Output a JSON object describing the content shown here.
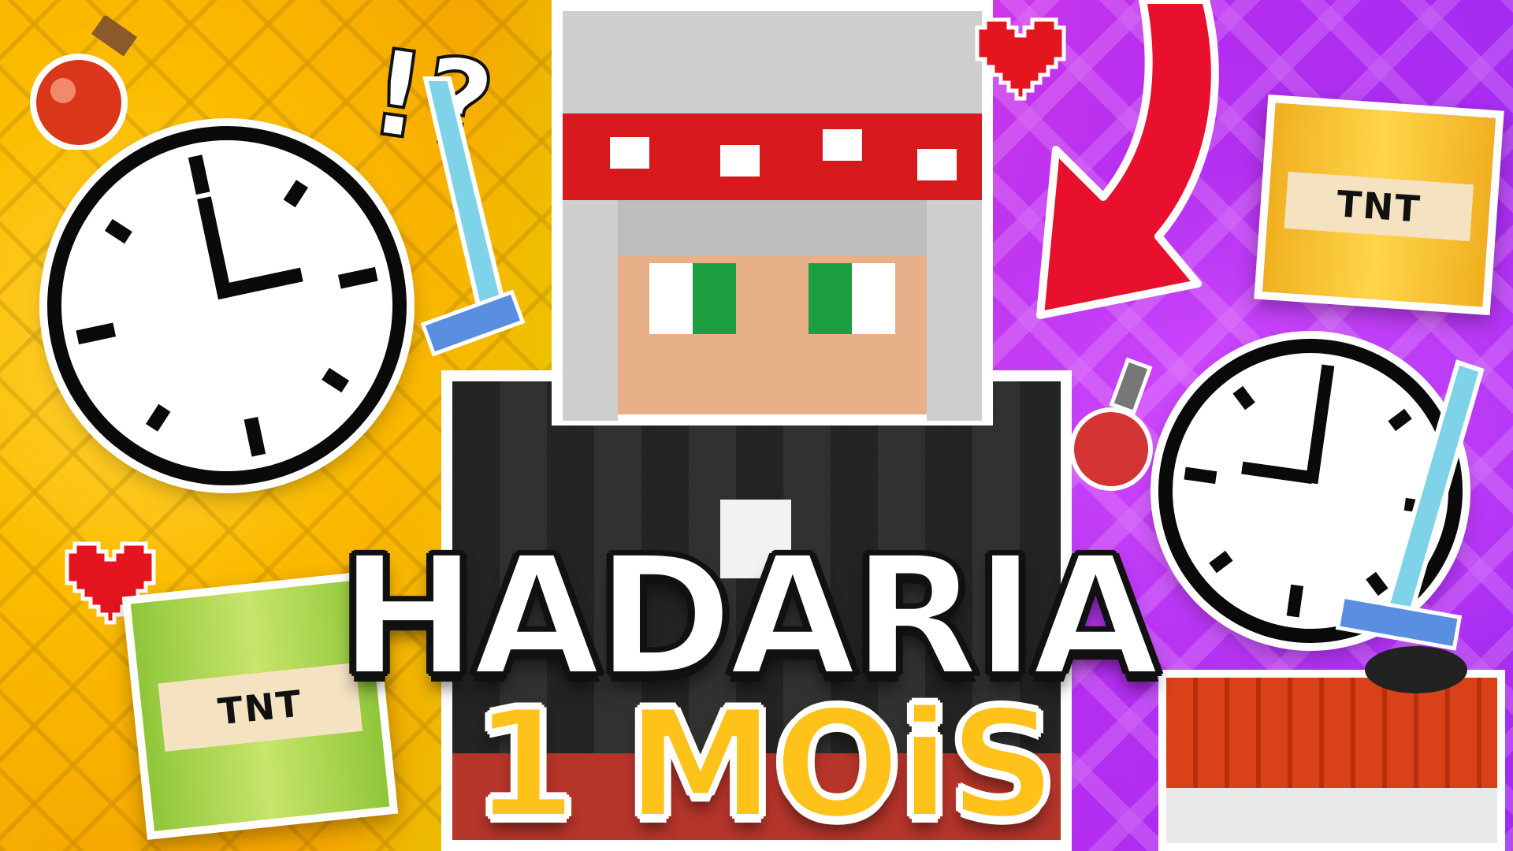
{
  "thumbnail": {
    "title": "HADARIA",
    "subtitle": "1 MOiS",
    "punctuation": "!?",
    "tnt_label": "TNT",
    "colors": {
      "left_background": "#f5a400",
      "right_background": "#b52cf0",
      "title_fill": "#ffffff",
      "subtitle_fill": "#ffc21a",
      "arrow": "#e8102c",
      "heart": "#e4151f",
      "clock_face": "#ffffff",
      "skin_headband": "#d7191e",
      "skin_eyes": "#1e9e42",
      "skin_shirt": "#2a2a2a"
    },
    "icons": [
      "clock-icon",
      "tnt-block-icon",
      "heart-icon",
      "diamond-sword-icon",
      "potion-icon",
      "arrow-icon",
      "minecraft-character"
    ]
  }
}
